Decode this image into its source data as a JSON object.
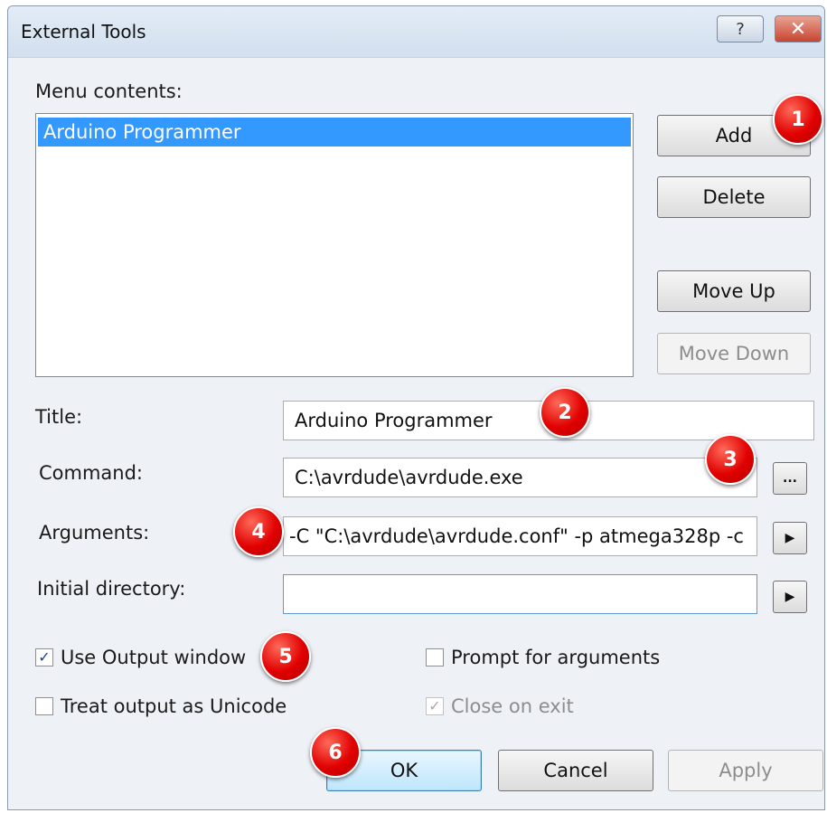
{
  "window": {
    "title": "External Tools",
    "help_glyph": "?",
    "close_glyph": "✕"
  },
  "menu": {
    "label": "Menu contents:",
    "items": [
      "Arduino Programmer"
    ],
    "selected_index": 0
  },
  "buttons": {
    "add": "Add",
    "delete": "Delete",
    "move_up": "Move Up",
    "move_down": "Move Down",
    "ok": "OK",
    "cancel": "Cancel",
    "apply": "Apply",
    "browse": "...",
    "arrow": "▶"
  },
  "fields": {
    "title": {
      "label": "Title:",
      "value": "Arduino Programmer"
    },
    "command": {
      "label": "Command:",
      "value": "C:\\avrdude\\avrdude.exe"
    },
    "arguments": {
      "label": "Arguments:",
      "value": "-C \"C:\\avrdude\\avrdude.conf\" -p atmega328p -c"
    },
    "initial_directory": {
      "label": "Initial directory:",
      "value": ""
    }
  },
  "checkboxes": {
    "use_output_window": {
      "label": "Use Output window",
      "checked": true,
      "mark": "✓"
    },
    "prompt_for_arguments": {
      "label": "Prompt for arguments",
      "checked": false,
      "mark": ""
    },
    "treat_output_as_unicode": {
      "label": "Treat output as Unicode",
      "checked": false,
      "mark": ""
    },
    "close_on_exit": {
      "label": "Close on exit",
      "checked": true,
      "disabled": true,
      "mark": "✓"
    }
  },
  "markers": [
    "1",
    "2",
    "3",
    "4",
    "5",
    "6"
  ],
  "colors": {
    "selection": "#3399ff",
    "marker": "#e00000"
  }
}
